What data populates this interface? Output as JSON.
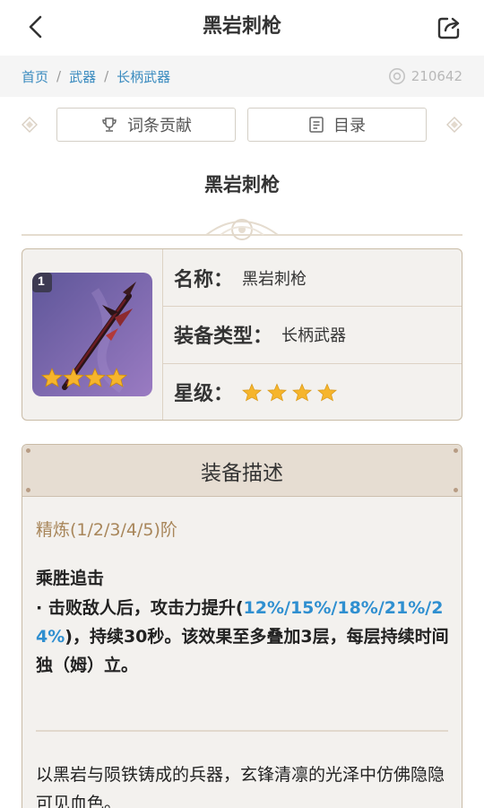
{
  "header": {
    "title": "黑岩刺枪"
  },
  "breadcrumb": {
    "items": [
      "首页",
      "武器",
      "长柄武器"
    ],
    "separator": "/"
  },
  "views": {
    "count": "210642"
  },
  "toolbar": {
    "contribute_label": "词条贡献",
    "toc_label": "目录"
  },
  "page_heading": "黑岩刺枪",
  "info": {
    "name_label": "名称：",
    "name_value": "黑岩刺枪",
    "type_label": "装备类型：",
    "type_value": "长柄武器",
    "rarity_label": "星级：",
    "rarity_stars": 4,
    "refine_badge": "1",
    "thumb_stars": 4
  },
  "description": {
    "header": "装备描述",
    "refinement": "精炼(1/2/3/4/5)阶",
    "skill_name": "乘胜追击",
    "skill_prefix": "· 击败敌人后，攻击力提升(",
    "skill_values": "12%/15%/18%/21%/24%",
    "skill_suffix": ")，持续30秒。该效果至多叠加3层，每层持续时间独（姆）立。",
    "lore": "以黑岩与陨铁铸成的兵器，玄锋清凛的光泽中仿佛隐隐可见血色。"
  },
  "colors": {
    "link": "#3a8bbf",
    "highlight": "#2f8fd0",
    "gold": "#a8865a",
    "star": "#f6b52c"
  },
  "icons": {
    "back": "chevron-left-icon",
    "share": "share-icon",
    "views": "eye-icon",
    "contribute": "trophy-icon",
    "toc": "list-icon"
  }
}
